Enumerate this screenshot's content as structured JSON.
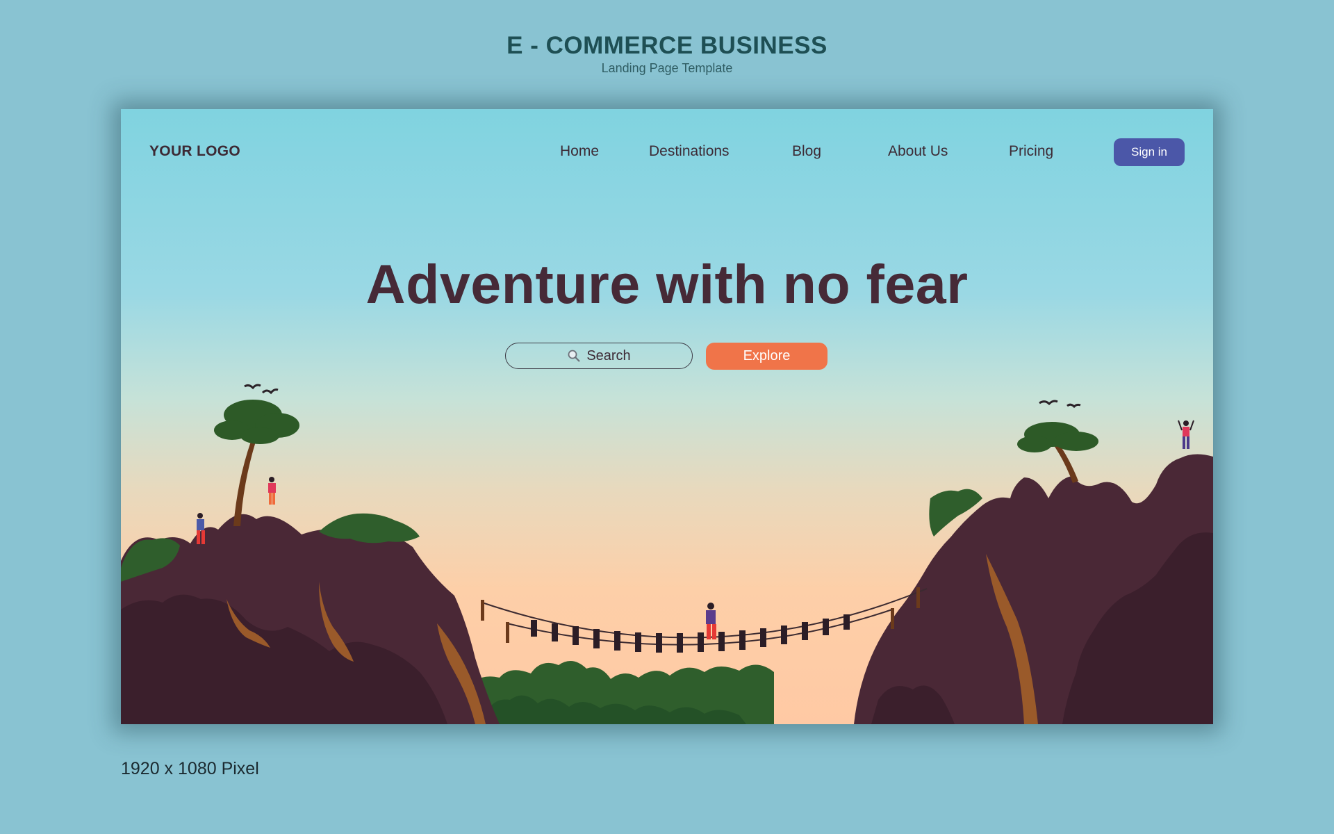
{
  "header": {
    "title": "E - COMMERCE BUSINESS",
    "subtitle": "Landing Page Template"
  },
  "landing": {
    "logo": "YOUR LOGO",
    "nav": [
      "Home",
      "Destinations",
      "Blog",
      "About Us",
      "Pricing"
    ],
    "signin_label": "Sign in",
    "headline": "Adventure with no fear",
    "search_label": "Search",
    "explore_label": "Explore",
    "colors": {
      "accent_orange": "#f07449",
      "signin_blue": "#4b57a8",
      "headline": "#462a37",
      "cliff": "#4a2836",
      "foliage": "#2f5e2c"
    }
  },
  "footer": {
    "size_caption": "1920 x 1080 Pixel"
  }
}
